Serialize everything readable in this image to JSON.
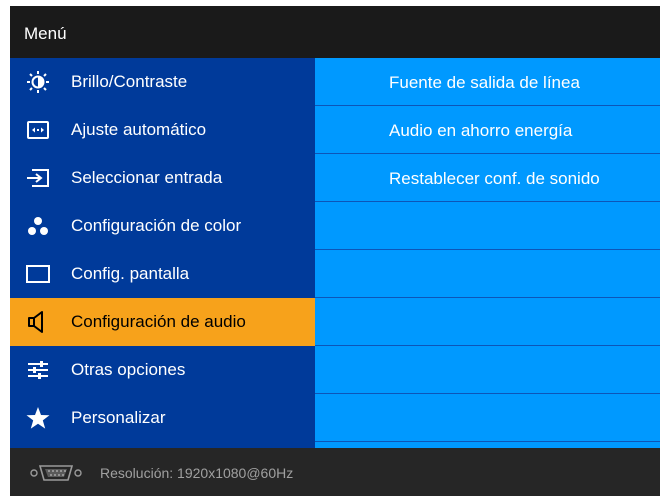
{
  "title": "Menú",
  "menu": [
    {
      "label": "Brillo/Contraste",
      "icon": "brightness-icon"
    },
    {
      "label": "Ajuste automático",
      "icon": "auto-adjust-icon"
    },
    {
      "label": "Seleccionar entrada",
      "icon": "input-source-icon"
    },
    {
      "label": "Configuración de color",
      "icon": "color-dots-icon"
    },
    {
      "label": "Config. pantalla",
      "icon": "display-icon"
    },
    {
      "label": "Configuración de audio",
      "icon": "speaker-icon",
      "selected": true
    },
    {
      "label": "Otras opciones",
      "icon": "sliders-icon"
    },
    {
      "label": "Personalizar",
      "icon": "star-icon"
    }
  ],
  "submenu": [
    "Fuente de salida de línea",
    "Audio en ahorro energía",
    "Restablecer conf. de sonido",
    "",
    "",
    "",
    "",
    ""
  ],
  "status": {
    "connector_icon": "vga-connector-icon",
    "resolution_label": "Resolución:",
    "resolution_value": "1920x1080@60Hz"
  },
  "colors": {
    "sidebar": "#003a9a",
    "panel": "#0099ff",
    "selected": "#f7a21b"
  }
}
